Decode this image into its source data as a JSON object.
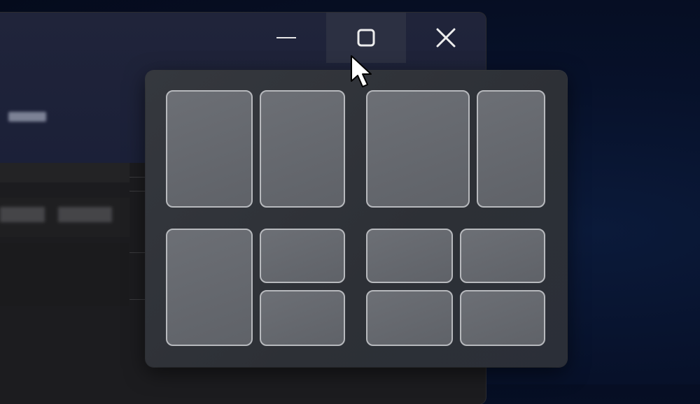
{
  "window": {
    "controls": [
      {
        "name": "minimize",
        "icon": "minimize-icon"
      },
      {
        "name": "maximize",
        "icon": "maximize-icon",
        "state": "hovered"
      },
      {
        "name": "close",
        "icon": "close-icon"
      }
    ]
  },
  "snap_layouts": {
    "layouts": [
      {
        "name": "two-equal-columns",
        "zones": 2
      },
      {
        "name": "wide-left-narrow-right",
        "zones": 2
      },
      {
        "name": "left-column-right-stacked",
        "zones": 3
      },
      {
        "name": "four-quadrants",
        "zones": 4
      }
    ]
  },
  "colors": {
    "flyout_bg": "#32353b",
    "zone_fill": "#65686e",
    "zone_border": "#b7b9bd",
    "accent_hover": "#2c3042"
  }
}
